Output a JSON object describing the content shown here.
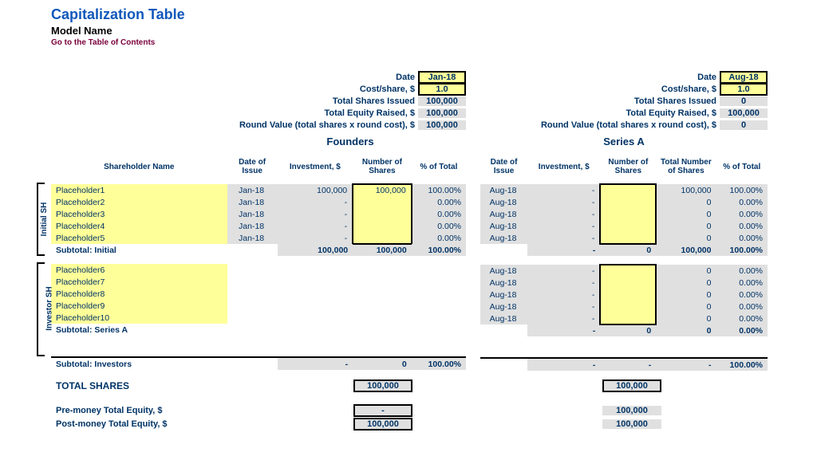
{
  "header": {
    "title": "Capitalization Table",
    "subtitle": "Model Name",
    "toc": "Go to the Table of Contents"
  },
  "labels": {
    "date": "Date",
    "cost_share": "Cost/share, $",
    "total_shares_issued": "Total Shares Issued",
    "total_equity_raised": "Total Equity Raised, $",
    "round_value": "Round Value (total shares x round cost), $",
    "shareholder_name": "Shareholder Name",
    "date_of_issue": "Date of Issue",
    "investment": "Investment, $",
    "number_of_shares": "Number of Shares",
    "total_number_of_shares": "Total Number of Shares",
    "pct_of_total": "% of Total",
    "initial_sh": "Initial SH",
    "investor_sh": "Investor SH",
    "subtotal_initial": "Subtotal: Initial",
    "subtotal_series_a": "Subtotal: Series A",
    "subtotal_investors": "Subtotal: Investors",
    "total_shares": "TOTAL SHARES",
    "pre_money": "Pre-money Total Equity, $",
    "post_money": "Post-money Total Equity, $"
  },
  "founders": {
    "round_name": "Founders",
    "date": "Jan-18",
    "cost_share": "1.0",
    "total_shares_issued": "100,000",
    "total_equity_raised": "100,000",
    "round_value": "100,000",
    "rows": [
      {
        "name": "Placeholder1",
        "doi": "Jan-18",
        "inv": "100,000",
        "shares": "100,000",
        "pct": "100.00%"
      },
      {
        "name": "Placeholder2",
        "doi": "Jan-18",
        "inv": "-",
        "shares": "",
        "pct": "0.00%"
      },
      {
        "name": "Placeholder3",
        "doi": "Jan-18",
        "inv": "-",
        "shares": "",
        "pct": "0.00%"
      },
      {
        "name": "Placeholder4",
        "doi": "Jan-18",
        "inv": "-",
        "shares": "",
        "pct": "0.00%"
      },
      {
        "name": "Placeholder5",
        "doi": "Jan-18",
        "inv": "-",
        "shares": "",
        "pct": "0.00%"
      }
    ],
    "subtotal": {
      "inv": "100,000",
      "shares": "100,000",
      "pct": "100.00%"
    },
    "sub_investors": {
      "inv": "-",
      "shares": "0",
      "pct": "100.00%"
    },
    "total_shares_box": "100,000",
    "pre_money": "-",
    "post_money": "100,000"
  },
  "series_a": {
    "round_name": "Series A",
    "date": "Aug-18",
    "cost_share": "1.0",
    "total_shares_issued": "0",
    "total_equity_raised": "100,000",
    "round_value": "0",
    "rows_initial": [
      {
        "doi": "Aug-18",
        "inv": "-",
        "shares": "",
        "tshares": "100,000",
        "pct": "100.00%"
      },
      {
        "doi": "Aug-18",
        "inv": "-",
        "shares": "",
        "tshares": "0",
        "pct": "0.00%"
      },
      {
        "doi": "Aug-18",
        "inv": "-",
        "shares": "",
        "tshares": "0",
        "pct": "0.00%"
      },
      {
        "doi": "Aug-18",
        "inv": "-",
        "shares": "",
        "tshares": "0",
        "pct": "0.00%"
      },
      {
        "doi": "Aug-18",
        "inv": "-",
        "shares": "",
        "tshares": "0",
        "pct": "0.00%"
      }
    ],
    "subtotal_initial": {
      "inv": "-",
      "shares": "0",
      "tshares": "100,000",
      "pct": "100.00%"
    },
    "rows_investor": [
      {
        "name": "Placeholder6",
        "doi": "Aug-18",
        "inv": "-",
        "shares": "",
        "tshares": "0",
        "pct": "0.00%"
      },
      {
        "name": "Placeholder7",
        "doi": "Aug-18",
        "inv": "-",
        "shares": "",
        "tshares": "0",
        "pct": "0.00%"
      },
      {
        "name": "Placeholder8",
        "doi": "Aug-18",
        "inv": "-",
        "shares": "",
        "tshares": "0",
        "pct": "0.00%"
      },
      {
        "name": "Placeholder9",
        "doi": "Aug-18",
        "inv": "-",
        "shares": "",
        "tshares": "0",
        "pct": "0.00%"
      },
      {
        "name": "Placeholder10",
        "doi": "Aug-18",
        "inv": "-",
        "shares": "",
        "tshares": "0",
        "pct": "0.00%"
      }
    ],
    "subtotal_series_a": {
      "inv": "-",
      "shares": "0",
      "tshares": "0",
      "pct": "0.00%"
    },
    "sub_investors": {
      "inv": "-",
      "shares": "-",
      "tshares": "-",
      "pct": "100.00%"
    },
    "total_shares_box": "100,000",
    "pre_money": "100,000",
    "post_money": "100,000"
  }
}
